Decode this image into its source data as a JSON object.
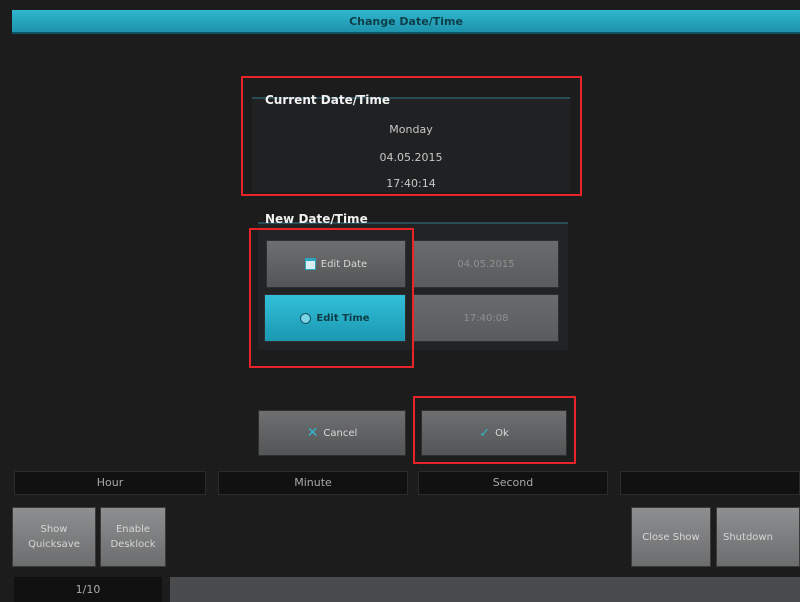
{
  "dialog": {
    "title": "Change Date/Time"
  },
  "current": {
    "heading": "Current Date/Time",
    "weekday": "Monday",
    "date": "04.05.2015",
    "time": "17:40:14"
  },
  "new": {
    "heading": "New Date/Time",
    "edit_date_label": "Edit Date",
    "date_value": "04.05.2015",
    "edit_time_label": "Edit Time",
    "time_value": "17:40:08"
  },
  "actions": {
    "cancel_label": "Cancel",
    "ok_label": "Ok"
  },
  "wheels": [
    "Hour",
    "Minute",
    "Second",
    ""
  ],
  "softkeys": {
    "show_quicksave": "Show Quicksave",
    "enable_desklock": "Enable Desklock",
    "close_show": "Close Show",
    "shutdown": "Shutdown"
  },
  "page": "1/10",
  "colors": {
    "accent": "#2fb6cf",
    "highlight": "#e8232a"
  }
}
